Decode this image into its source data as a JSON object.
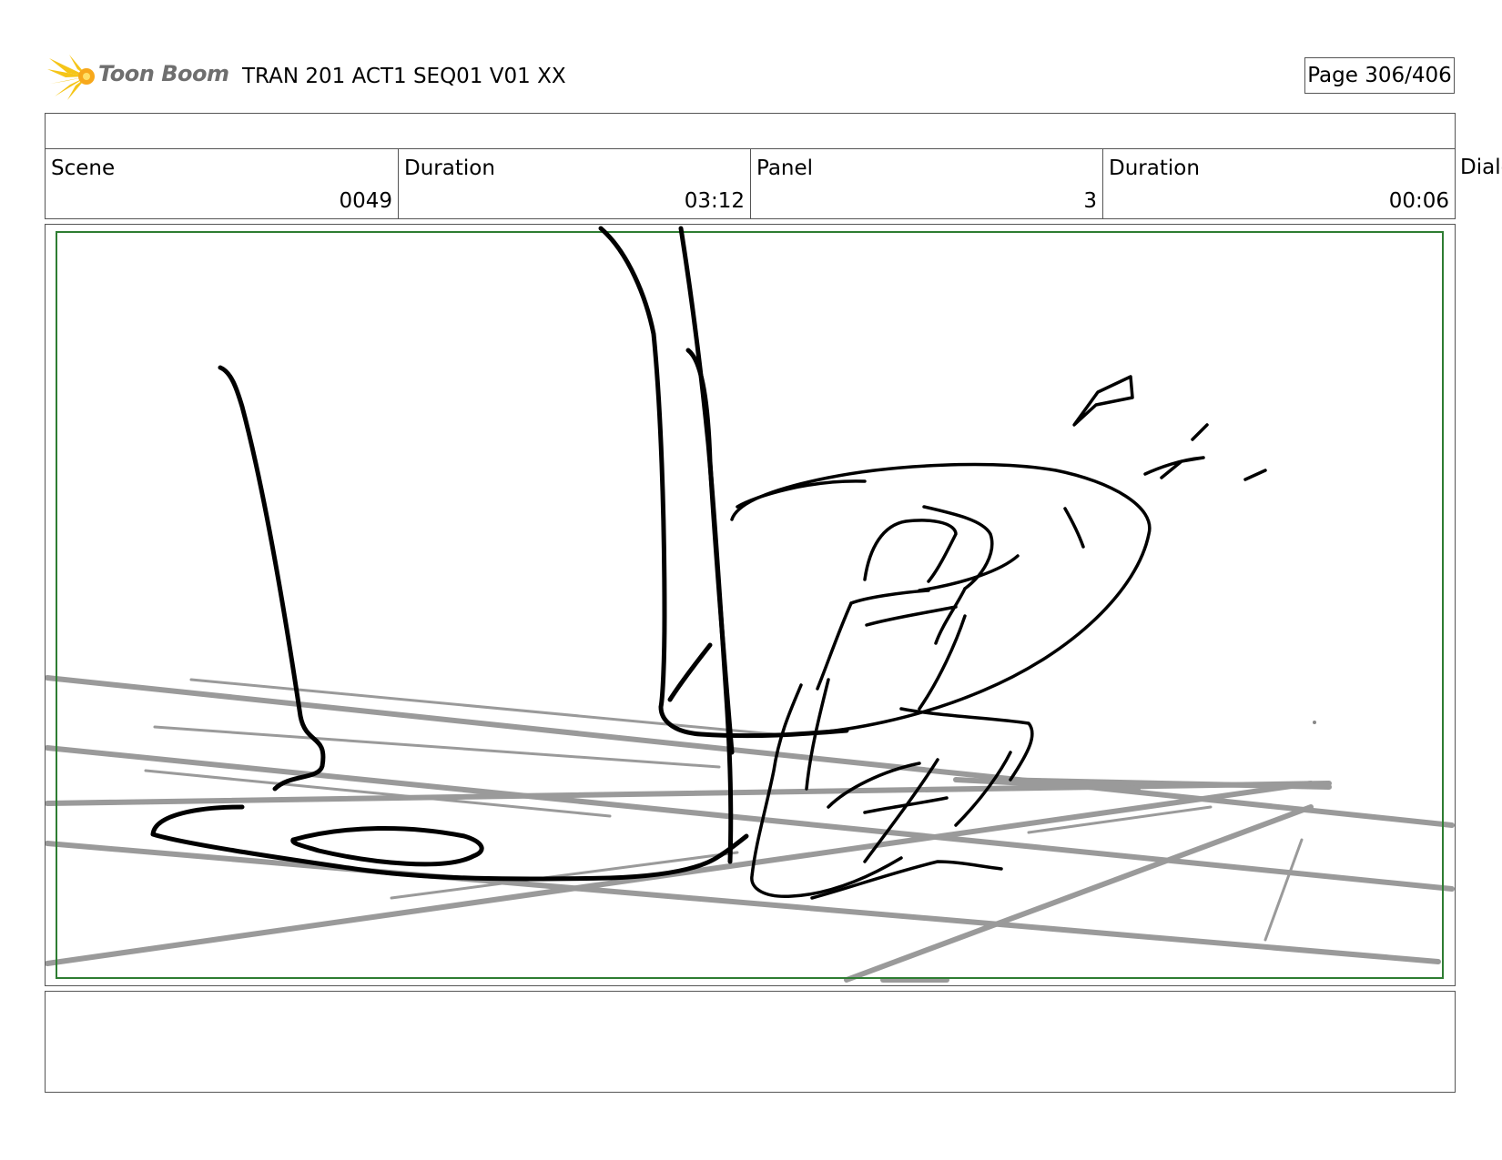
{
  "header": {
    "logo_text": "Toon Boom",
    "title": "TRAN 201 ACT1 SEQ01 V01 XX",
    "page": "Page 306/406"
  },
  "info": {
    "scene_label": "Scene",
    "scene_value": "0049",
    "scene_duration_label": "Duration",
    "scene_duration_value": "03:12",
    "panel_label": "Panel",
    "panel_value": "3",
    "panel_duration_label": "Duration",
    "panel_duration_value": "00:06",
    "dialogue_label": "Dialo"
  },
  "colors": {
    "safe_frame": "#2e7d32",
    "floor_lines": "#9a9a9a",
    "logo_star": "#f5c518",
    "logo_text": "#6f6f6f"
  }
}
